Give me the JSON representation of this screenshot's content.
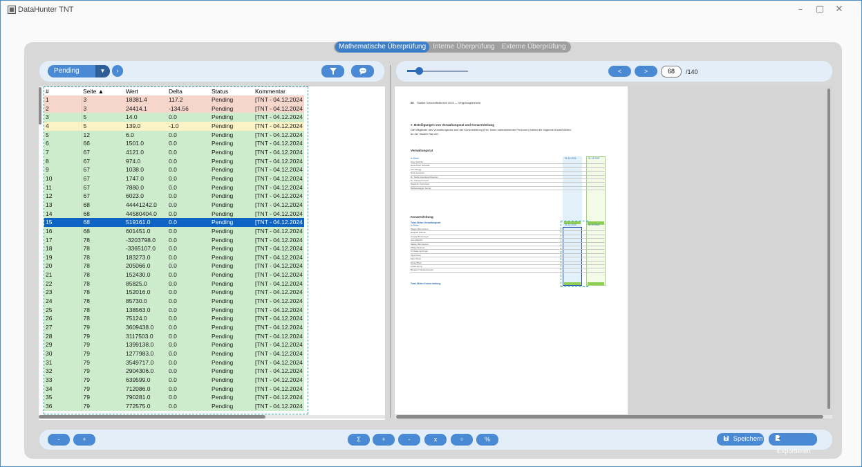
{
  "window": {
    "title": "DataHunter TNT",
    "minimize": "–",
    "maximize": "▢",
    "close": "✕"
  },
  "tabs": [
    {
      "label": "Mathematische Überprüfung",
      "active": true
    },
    {
      "label": "Interne Überprüfung",
      "active": false
    },
    {
      "label": "Externe Überprüfung",
      "active": false
    }
  ],
  "left_toolbar": {
    "status_filter": "Pending",
    "dropdown_icon": "chevron-down-icon",
    "next_icon": "chevron-right-icon",
    "filter_icon": "funnel-icon",
    "comment_icon": "speech-bubble-icon"
  },
  "table": {
    "columns": [
      "#",
      "Seite ▲",
      "Wert",
      "Delta",
      "Status",
      "Kommentar"
    ],
    "rows": [
      {
        "n": "1",
        "seite": "3",
        "wert": "18381.4",
        "delta": "117.2",
        "status": "Pending",
        "kommentar": "[TNT - 04.12.2024",
        "color": "red"
      },
      {
        "n": "2",
        "seite": "3",
        "wert": "24414.1",
        "delta": "-134.56",
        "status": "Pending",
        "kommentar": "[TNT - 04.12.2024",
        "color": "red"
      },
      {
        "n": "3",
        "seite": "5",
        "wert": "14.0",
        "delta": "0.0",
        "status": "Pending",
        "kommentar": "[TNT - 04.12.2024",
        "color": "green"
      },
      {
        "n": "4",
        "seite": "5",
        "wert": "139.0",
        "delta": "-1.0",
        "status": "Pending",
        "kommentar": "[TNT - 04.12.2024",
        "color": "yellow"
      },
      {
        "n": "5",
        "seite": "12",
        "wert": "6.0",
        "delta": "0.0",
        "status": "Pending",
        "kommentar": "[TNT - 04.12.2024",
        "color": "green"
      },
      {
        "n": "6",
        "seite": "66",
        "wert": "1501.0",
        "delta": "0.0",
        "status": "Pending",
        "kommentar": "[TNT - 04.12.2024",
        "color": "green"
      },
      {
        "n": "7",
        "seite": "67",
        "wert": "4121.0",
        "delta": "0.0",
        "status": "Pending",
        "kommentar": "[TNT - 04.12.2024",
        "color": "green"
      },
      {
        "n": "8",
        "seite": "67",
        "wert": "974.0",
        "delta": "0.0",
        "status": "Pending",
        "kommentar": "[TNT - 04.12.2024",
        "color": "green"
      },
      {
        "n": "9",
        "seite": "67",
        "wert": "1038.0",
        "delta": "0.0",
        "status": "Pending",
        "kommentar": "[TNT - 04.12.2024",
        "color": "green"
      },
      {
        "n": "10",
        "seite": "67",
        "wert": "1747.0",
        "delta": "0.0",
        "status": "Pending",
        "kommentar": "[TNT - 04.12.2024",
        "color": "green"
      },
      {
        "n": "11",
        "seite": "67",
        "wert": "7880.0",
        "delta": "0.0",
        "status": "Pending",
        "kommentar": "[TNT - 04.12.2024",
        "color": "green"
      },
      {
        "n": "12",
        "seite": "67",
        "wert": "6023.0",
        "delta": "0.0",
        "status": "Pending",
        "kommentar": "[TNT - 04.12.2024",
        "color": "green"
      },
      {
        "n": "13",
        "seite": "68",
        "wert": "44441242.0",
        "delta": "0.0",
        "status": "Pending",
        "kommentar": "[TNT - 04.12.2024",
        "color": "green"
      },
      {
        "n": "14",
        "seite": "68",
        "wert": "44580404.0",
        "delta": "0.0",
        "status": "Pending",
        "kommentar": "[TNT - 04.12.2024",
        "color": "green"
      },
      {
        "n": "15",
        "seite": "68",
        "wert": "519161.0",
        "delta": "0.0",
        "status": "Pending",
        "kommentar": "[TNT - 04.12.2024",
        "color": "selected"
      },
      {
        "n": "16",
        "seite": "68",
        "wert": "601451.0",
        "delta": "0.0",
        "status": "Pending",
        "kommentar": "[TNT - 04.12.2024",
        "color": "green"
      },
      {
        "n": "17",
        "seite": "78",
        "wert": "-3203798.0",
        "delta": "0.0",
        "status": "Pending",
        "kommentar": "[TNT - 04.12.2024",
        "color": "green"
      },
      {
        "n": "18",
        "seite": "78",
        "wert": "-3365107.0",
        "delta": "0.0",
        "status": "Pending",
        "kommentar": "[TNT - 04.12.2024",
        "color": "green"
      },
      {
        "n": "19",
        "seite": "78",
        "wert": "183273.0",
        "delta": "0.0",
        "status": "Pending",
        "kommentar": "[TNT - 04.12.2024",
        "color": "green"
      },
      {
        "n": "20",
        "seite": "78",
        "wert": "205066.0",
        "delta": "0.0",
        "status": "Pending",
        "kommentar": "[TNT - 04.12.2024",
        "color": "green"
      },
      {
        "n": "21",
        "seite": "78",
        "wert": "152430.0",
        "delta": "0.0",
        "status": "Pending",
        "kommentar": "[TNT - 04.12.2024",
        "color": "green"
      },
      {
        "n": "22",
        "seite": "78",
        "wert": "85825.0",
        "delta": "0.0",
        "status": "Pending",
        "kommentar": "[TNT - 04.12.2024",
        "color": "green"
      },
      {
        "n": "23",
        "seite": "78",
        "wert": "152016.0",
        "delta": "0.0",
        "status": "Pending",
        "kommentar": "[TNT - 04.12.2024",
        "color": "green"
      },
      {
        "n": "24",
        "seite": "78",
        "wert": "85730.0",
        "delta": "0.0",
        "status": "Pending",
        "kommentar": "[TNT - 04.12.2024",
        "color": "green"
      },
      {
        "n": "25",
        "seite": "78",
        "wert": "138563.0",
        "delta": "0.0",
        "status": "Pending",
        "kommentar": "[TNT - 04.12.2024",
        "color": "green"
      },
      {
        "n": "26",
        "seite": "78",
        "wert": "75124.0",
        "delta": "0.0",
        "status": "Pending",
        "kommentar": "[TNT - 04.12.2024",
        "color": "green"
      },
      {
        "n": "27",
        "seite": "79",
        "wert": "3609438.0",
        "delta": "0.0",
        "status": "Pending",
        "kommentar": "[TNT - 04.12.2024",
        "color": "green"
      },
      {
        "n": "28",
        "seite": "79",
        "wert": "3117503.0",
        "delta": "0.0",
        "status": "Pending",
        "kommentar": "[TNT - 04.12.2024",
        "color": "green"
      },
      {
        "n": "29",
        "seite": "79",
        "wert": "1399138.0",
        "delta": "0.0",
        "status": "Pending",
        "kommentar": "[TNT - 04.12.2024",
        "color": "green"
      },
      {
        "n": "30",
        "seite": "79",
        "wert": "1277983.0",
        "delta": "0.0",
        "status": "Pending",
        "kommentar": "[TNT - 04.12.2024",
        "color": "green"
      },
      {
        "n": "31",
        "seite": "79",
        "wert": "3549717.0",
        "delta": "0.0",
        "status": "Pending",
        "kommentar": "[TNT - 04.12.2024",
        "color": "green"
      },
      {
        "n": "32",
        "seite": "79",
        "wert": "2904306.0",
        "delta": "0.0",
        "status": "Pending",
        "kommentar": "[TNT - 04.12.2024",
        "color": "green"
      },
      {
        "n": "33",
        "seite": "79",
        "wert": "639599.0",
        "delta": "0.0",
        "status": "Pending",
        "kommentar": "[TNT - 04.12.2024",
        "color": "green"
      },
      {
        "n": "34",
        "seite": "79",
        "wert": "712086.0",
        "delta": "0.0",
        "status": "Pending",
        "kommentar": "[TNT - 04.12.2024",
        "color": "green"
      },
      {
        "n": "35",
        "seite": "79",
        "wert": "790281.0",
        "delta": "0.0",
        "status": "Pending",
        "kommentar": "[TNT - 04.12.2024",
        "color": "green"
      },
      {
        "n": "36",
        "seite": "79",
        "wert": "772575.0",
        "delta": "0.0",
        "status": "Pending",
        "kommentar": "[TNT - 04.12.2024",
        "color": "green"
      }
    ]
  },
  "right_toolbar": {
    "zoom_level": 0.17,
    "prev_label": "<",
    "next_label": ">",
    "page_current": "68",
    "page_total": "/140"
  },
  "document": {
    "header": "Stadler Geschäftsbericht 2023 — Vergütungsbericht",
    "header_page": "68",
    "section_title": "7. Beteiligungen von Verwaltungsrat und Konzernleitung",
    "intro": "Die Mitglieder des Verwaltungsrats und der Konzernleitung (inkl. ihnen nahestehender Personen) halten die folgende Anzahl Aktien",
    "intro2": "an der Stadler Rail AG:",
    "vr_title": "Verwaltungsrat",
    "kl_title": "Konzernleitung",
    "col_unit": "in Stück",
    "col_a": "31.12.2023",
    "col_b": "31.12.2022",
    "vr_total_label": "Total Aktien Verwaltungsrat",
    "kl_total_label": "Total Aktien Konzernleitung",
    "vr_rows": [
      "Peter Spuhler",
      "Hans-Peter Schwald",
      "Kurt Rüegg",
      "Doris Leuthard",
      "Dr. Stefan Asenkerschbaumer",
      "Dr. Christoph Franz",
      "Wojciech Kostrzewa",
      "Barbara Egger-Jenzer"
    ],
    "kl_rows": [
      "Markus Bernsteiner",
      "Raphael Widmer",
      "Ansgar Brockmeyer",
      "Jure Mikolčić",
      "Markus Bernsteiner",
      "Philipp Brunner",
      "Christian Spichiger",
      "Iñigo Parra",
      "Marc Plüss",
      "Daniel Blum",
      "Lukas Gerny",
      "Benjamin Weidenhausen"
    ]
  },
  "bottom_toolbar": {
    "left_buttons": [
      "-",
      "+"
    ],
    "ops": [
      "Σ",
      "+",
      "-",
      "x",
      "÷",
      "%"
    ],
    "save_label": "Speichern",
    "export_label": "Exportieren",
    "save_icon": "save-icon",
    "export_icon": "export-icon"
  },
  "colors": {
    "accent": "#4a8ad4",
    "selected_row": "#0d64c5",
    "row_red": "#f6d5cb",
    "row_green": "#cdeccb",
    "row_yellow": "#fbf3c5",
    "selection_border": "#2aa69e"
  }
}
